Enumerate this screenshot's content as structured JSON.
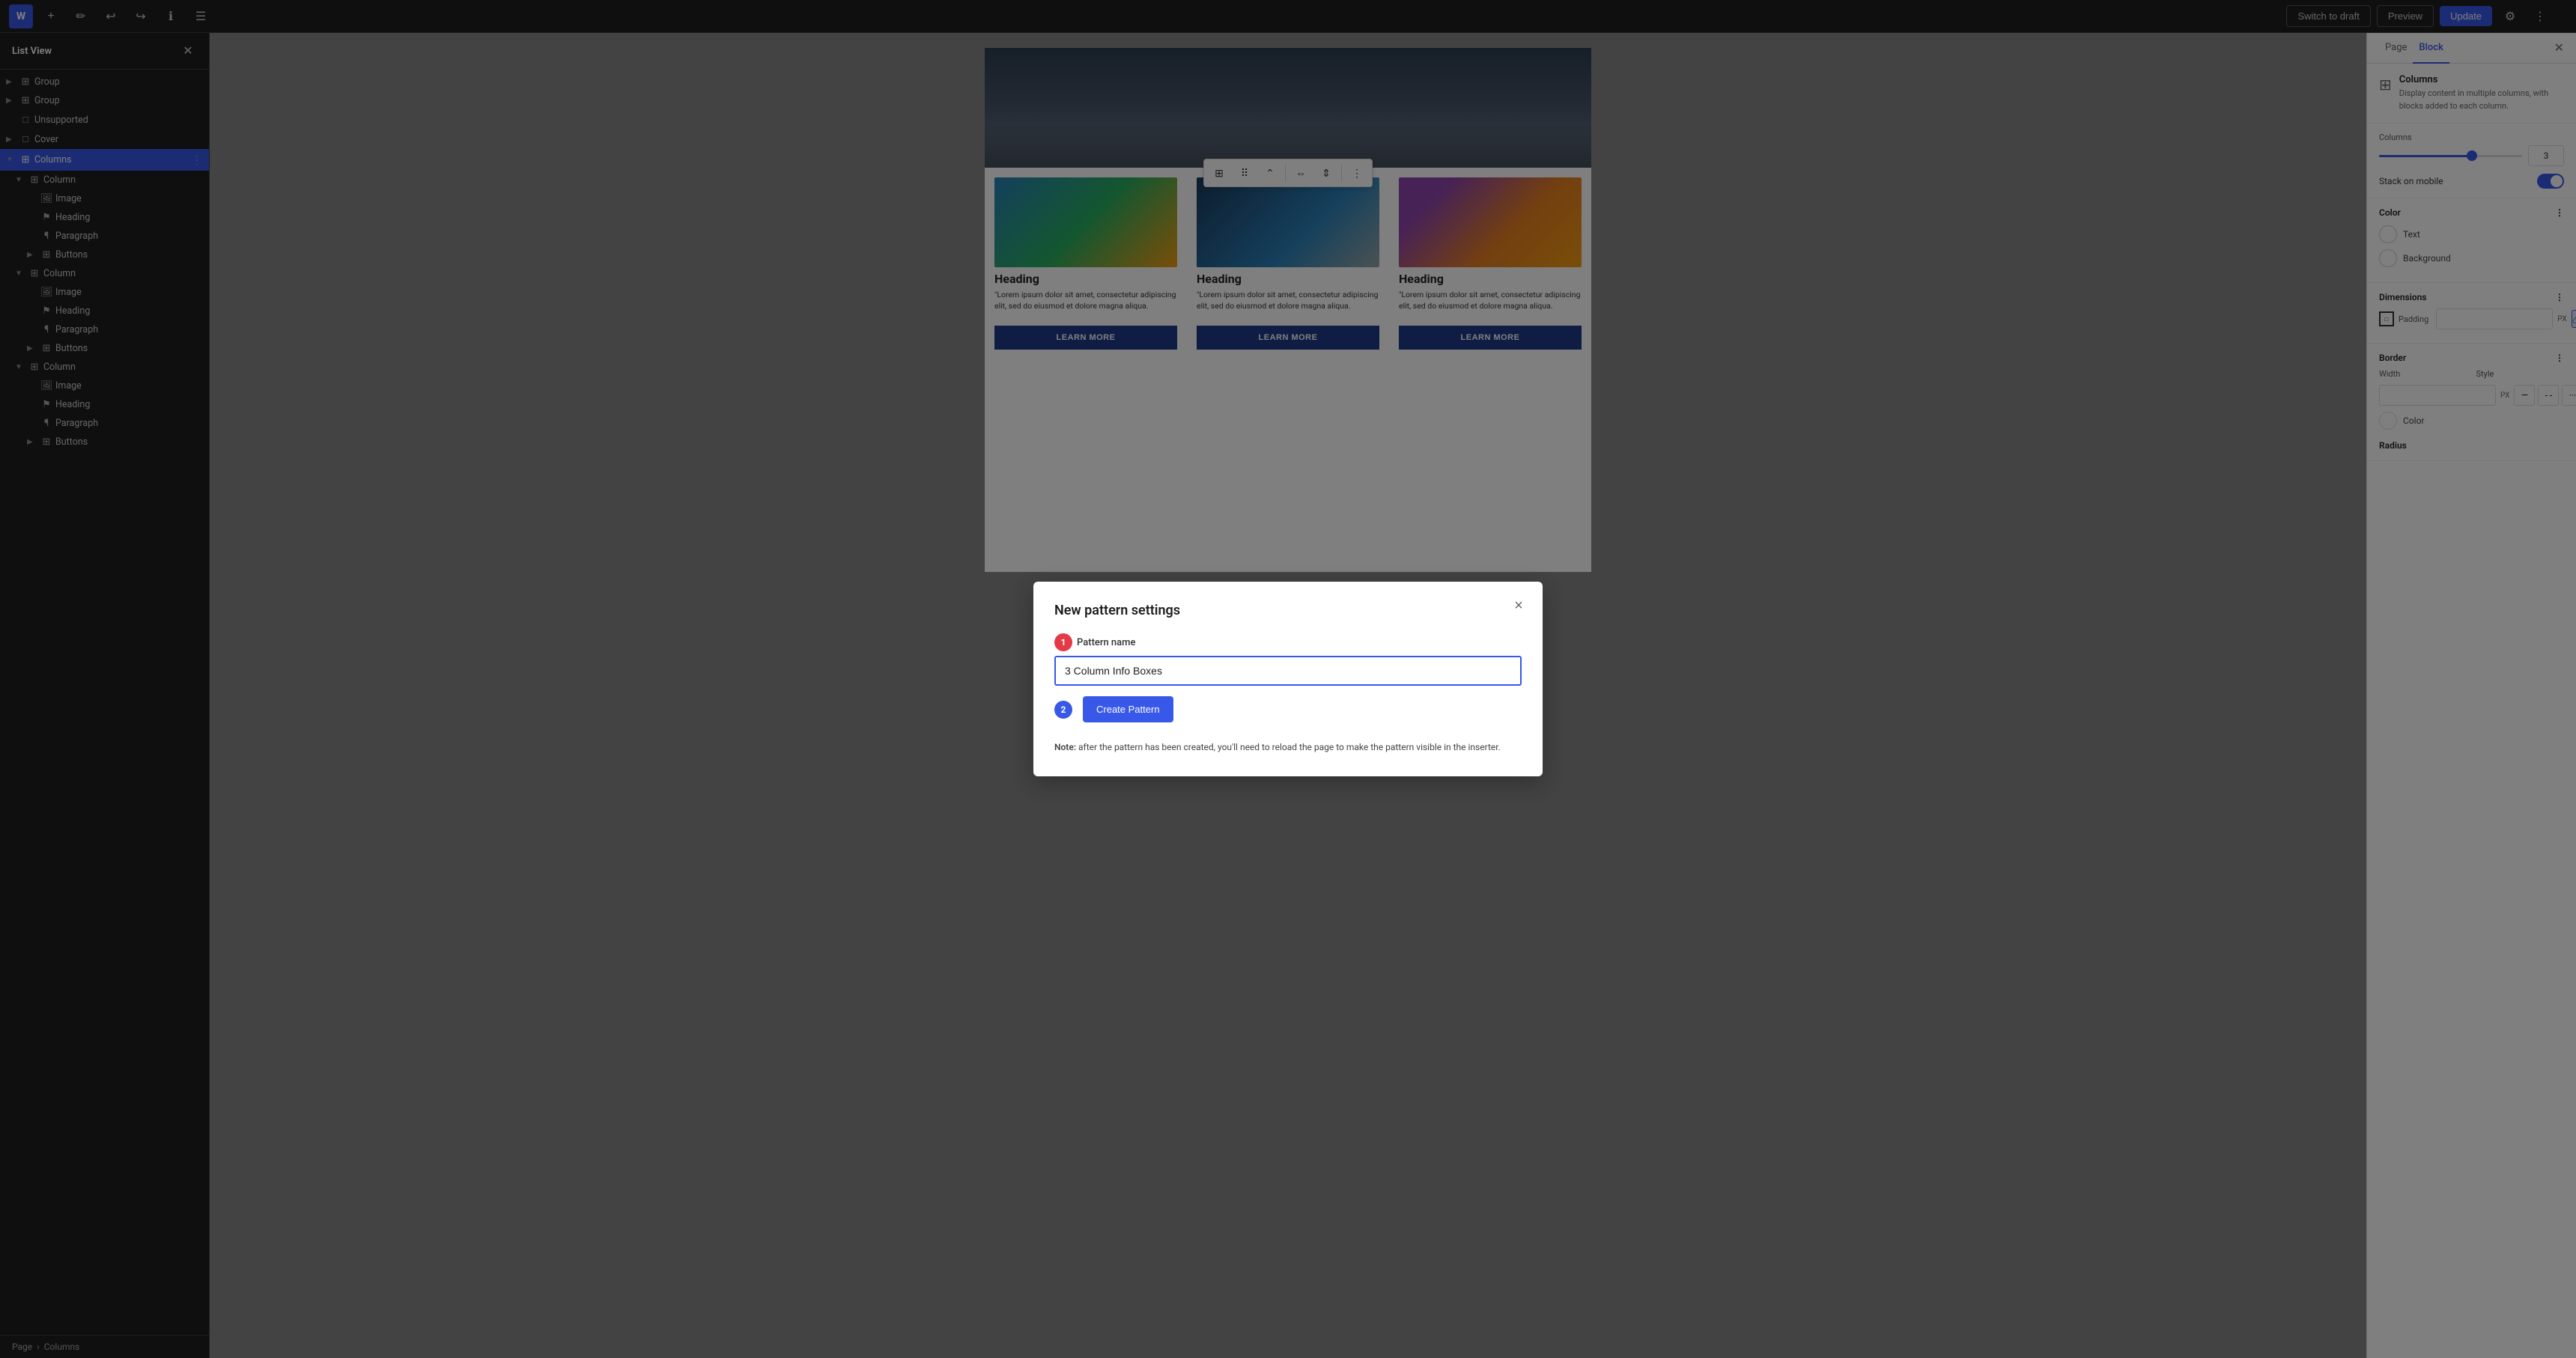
{
  "toolbar": {
    "wp_logo": "W",
    "add_label": "+",
    "edit_label": "✏",
    "undo_label": "↩",
    "redo_label": "↪",
    "info_label": "ℹ",
    "list_label": "☰",
    "switch_to_draft_label": "Switch to draft",
    "preview_label": "Preview",
    "update_label": "Update",
    "settings_label": "⚙"
  },
  "sidebar": {
    "title": "List View",
    "close_label": "✕",
    "items": [
      {
        "id": "group1",
        "label": "Group",
        "level": 0,
        "icon": "⊞",
        "expand": "▶"
      },
      {
        "id": "group2",
        "label": "Group",
        "level": 0,
        "icon": "⊞",
        "expand": "▶"
      },
      {
        "id": "unsupported",
        "label": "Unsupported",
        "level": 0,
        "icon": "□",
        "expand": ""
      },
      {
        "id": "cover",
        "label": "Cover",
        "level": 0,
        "icon": "□",
        "expand": "▶"
      },
      {
        "id": "columns",
        "label": "Columns",
        "level": 0,
        "icon": "⊞",
        "expand": "▼",
        "active": true
      },
      {
        "id": "column1",
        "label": "Column",
        "level": 1,
        "icon": "⊞",
        "expand": "▼"
      },
      {
        "id": "image1",
        "label": "Image",
        "level": 2,
        "icon": "🖼",
        "expand": ""
      },
      {
        "id": "heading1",
        "label": "Heading",
        "level": 2,
        "icon": "⚑",
        "expand": ""
      },
      {
        "id": "paragraph1",
        "label": "Paragraph",
        "level": 2,
        "icon": "¶",
        "expand": ""
      },
      {
        "id": "buttons1",
        "label": "Buttons",
        "level": 2,
        "icon": "⊞",
        "expand": "▶"
      },
      {
        "id": "column2",
        "label": "Column",
        "level": 1,
        "icon": "⊞",
        "expand": "▼"
      },
      {
        "id": "image2",
        "label": "Image",
        "level": 2,
        "icon": "🖼",
        "expand": ""
      },
      {
        "id": "heading2",
        "label": "Heading",
        "level": 2,
        "icon": "⚑",
        "expand": ""
      },
      {
        "id": "paragraph2",
        "label": "Paragraph",
        "level": 2,
        "icon": "¶",
        "expand": ""
      },
      {
        "id": "buttons2",
        "label": "Buttons",
        "level": 2,
        "icon": "⊞",
        "expand": "▶"
      },
      {
        "id": "column3",
        "label": "Column",
        "level": 1,
        "icon": "⊞",
        "expand": "▼"
      },
      {
        "id": "image3",
        "label": "Image",
        "level": 2,
        "icon": "🖼",
        "expand": ""
      },
      {
        "id": "heading3",
        "label": "Heading",
        "level": 2,
        "icon": "⚑",
        "expand": ""
      },
      {
        "id": "paragraph3",
        "label": "Paragraph",
        "level": 2,
        "icon": "¶",
        "expand": ""
      },
      {
        "id": "buttons3",
        "label": "Buttons",
        "level": 2,
        "icon": "⊞",
        "expand": "▶"
      }
    ],
    "breadcrumb_page": "Page",
    "breadcrumb_sep": "›",
    "breadcrumb_current": "Columns"
  },
  "block_toolbar": {
    "columns_icon": "⊞",
    "drag_icon": "⠿",
    "move_icon": "⌃",
    "align_icon": "⇔",
    "valign_icon": "⇕",
    "more_icon": "⋮"
  },
  "canvas": {
    "columns": [
      {
        "heading": "Heading",
        "paragraph": "\"Lorem ipsum dolor sit amet, consectetur adipiscing elit, sed do eiusmod et dolore magna aliqua.",
        "button_label": "LEARN MORE"
      },
      {
        "heading": "Heading",
        "paragraph": "\"Lorem ipsum dolor sit amet, consectetur adipiscing elit, sed do eiusmod et dolore magna aliqua.",
        "button_label": "LEARN MORE"
      },
      {
        "heading": "Heading",
        "paragraph": "\"Lorem ipsum dolor sit amet, consectetur adipiscing elit, sed do eiusmod et dolore magna aliqua.",
        "button_label": "LEARN MORE"
      }
    ]
  },
  "right_panel": {
    "tab_page": "Page",
    "tab_block": "Block",
    "active_tab": "Block",
    "close_label": "✕",
    "block_icon": "⊞",
    "block_name": "Columns",
    "block_desc": "Display content in multiple columns, with blocks added to each column.",
    "columns_label": "Columns",
    "columns_value": "3",
    "stack_on_mobile_label": "Stack on mobile",
    "color_label": "Color",
    "text_label": "Text",
    "background_label": "Background",
    "dimensions_label": "Dimensions",
    "padding_label": "Padding",
    "padding_value": "",
    "padding_unit": "PX",
    "border_label": "Border",
    "border_width_label": "Width",
    "border_style_label": "Style",
    "border_color_label": "Color",
    "radius_label": "Radius",
    "more_icon": "⋮"
  },
  "modal": {
    "title": "New pattern settings",
    "close_label": "×",
    "pattern_name_label": "Pattern name",
    "pattern_name_value": "3 Column Info Boxes",
    "create_button_label": "Create Pattern",
    "note_text": "Note: after the pattern has been created, you'll need to reload the page to make the pattern visible in the inserter.",
    "step1_color": "#e63946",
    "step2_color": "#3858e9"
  }
}
